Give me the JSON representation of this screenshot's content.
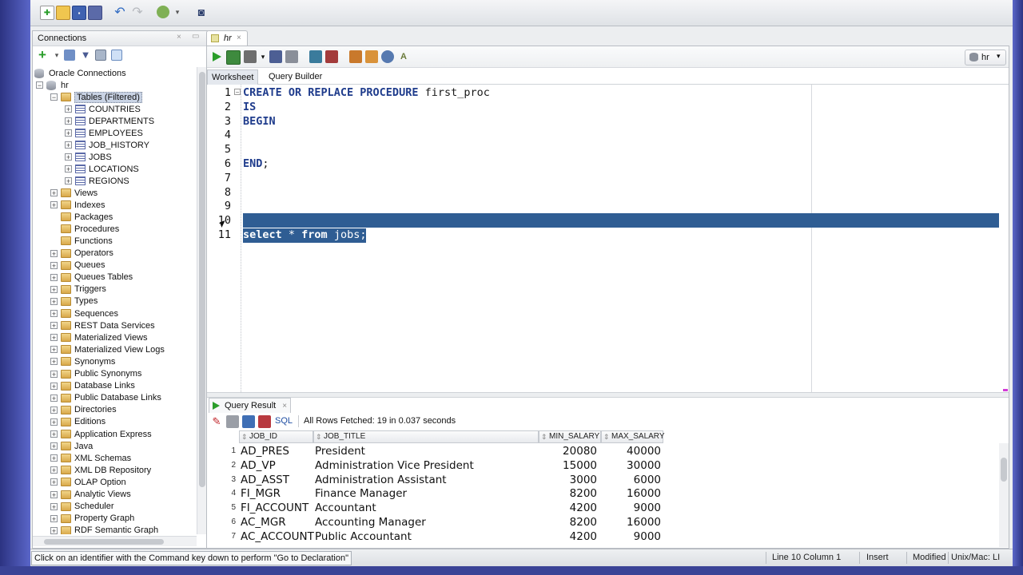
{
  "colors": {
    "selection": "#2f5d93",
    "keyword": "#1f3c8c",
    "run_green": "#2a9d2a",
    "sql_link": "#1f4ea3"
  },
  "connections": {
    "title": "Connections",
    "root": "Oracle Connections",
    "connection": "hr",
    "tables_label": "Tables (Filtered)",
    "tables": [
      "COUNTRIES",
      "DEPARTMENTS",
      "EMPLOYEES",
      "JOB_HISTORY",
      "JOBS",
      "LOCATIONS",
      "REGIONS"
    ],
    "nodes": [
      {
        "label": "Views",
        "exp": true
      },
      {
        "label": "Indexes",
        "exp": true
      },
      {
        "label": "Packages",
        "exp": false
      },
      {
        "label": "Procedures",
        "exp": false
      },
      {
        "label": "Functions",
        "exp": false
      },
      {
        "label": "Operators",
        "exp": true
      },
      {
        "label": "Queues",
        "exp": true
      },
      {
        "label": "Queues Tables",
        "exp": true
      },
      {
        "label": "Triggers",
        "exp": true
      },
      {
        "label": "Types",
        "exp": true
      },
      {
        "label": "Sequences",
        "exp": true
      },
      {
        "label": "REST Data Services",
        "exp": true
      },
      {
        "label": "Materialized Views",
        "exp": true
      },
      {
        "label": "Materialized View Logs",
        "exp": true
      },
      {
        "label": "Synonyms",
        "exp": true
      },
      {
        "label": "Public Synonyms",
        "exp": true
      },
      {
        "label": "Database Links",
        "exp": true
      },
      {
        "label": "Public Database Links",
        "exp": true
      },
      {
        "label": "Directories",
        "exp": true
      },
      {
        "label": "Editions",
        "exp": true
      },
      {
        "label": "Application Express",
        "exp": true
      },
      {
        "label": "Java",
        "exp": true
      },
      {
        "label": "XML Schemas",
        "exp": true
      },
      {
        "label": "XML DB Repository",
        "exp": true
      },
      {
        "label": "OLAP Option",
        "exp": true
      },
      {
        "label": "Analytic Views",
        "exp": true
      },
      {
        "label": "Scheduler",
        "exp": true
      },
      {
        "label": "Property Graph",
        "exp": true
      },
      {
        "label": "RDF Semantic Graph",
        "exp": true
      }
    ]
  },
  "editor": {
    "tab_label": "hr",
    "connection_selector": "hr",
    "subtabs": [
      "Worksheet",
      "Query Builder"
    ],
    "lines": [
      {
        "n": "1",
        "parts": [
          {
            "t": "CREATE OR REPLACE PROCEDURE",
            "kw": true
          },
          {
            "t": " first_proc",
            "kw": false
          }
        ]
      },
      {
        "n": "2",
        "parts": [
          {
            "t": "IS",
            "kw": true
          }
        ]
      },
      {
        "n": "3",
        "parts": [
          {
            "t": "BEGIN",
            "kw": true
          }
        ]
      },
      {
        "n": "4",
        "parts": []
      },
      {
        "n": "5",
        "parts": []
      },
      {
        "n": "6",
        "parts": [
          {
            "t": "END",
            "kw": true
          },
          {
            "t": ";",
            "kw": false
          }
        ]
      },
      {
        "n": "7",
        "parts": []
      },
      {
        "n": "8",
        "parts": []
      },
      {
        "n": "9",
        "parts": []
      },
      {
        "n": "10",
        "parts": []
      },
      {
        "n": "11",
        "parts": [
          {
            "t": "select",
            "kw": true
          },
          {
            "t": " * ",
            "kw": false
          },
          {
            "t": "from",
            "kw": true
          },
          {
            "t": " jobs;",
            "kw": false
          }
        ]
      }
    ]
  },
  "results": {
    "tab_label": "Query Result",
    "sql_label": "SQL",
    "status": "All Rows Fetched: 19 in 0.037 seconds",
    "columns": [
      "JOB_ID",
      "JOB_TITLE",
      "MIN_SALARY",
      "MAX_SALARY"
    ],
    "rows": [
      [
        "1",
        "AD_PRES",
        "President",
        "20080",
        "40000"
      ],
      [
        "2",
        "AD_VP",
        "Administration Vice President",
        "15000",
        "30000"
      ],
      [
        "3",
        "AD_ASST",
        "Administration Assistant",
        "3000",
        "6000"
      ],
      [
        "4",
        "FI_MGR",
        "Finance Manager",
        "8200",
        "16000"
      ],
      [
        "5",
        "FI_ACCOUNT",
        "Accountant",
        "4200",
        "9000"
      ],
      [
        "6",
        "AC_MGR",
        "Accounting Manager",
        "8200",
        "16000"
      ],
      [
        "7",
        "AC_ACCOUNT",
        "Public Accountant",
        "4200",
        "9000"
      ]
    ]
  },
  "statusbar": {
    "hint": "Click on an identifier with the Command key down to perform \"Go to Declaration\"",
    "position": "Line 10 Column 1",
    "mode": "Insert",
    "modified": "Modified",
    "line_ending": "Unix/Mac: LI"
  }
}
